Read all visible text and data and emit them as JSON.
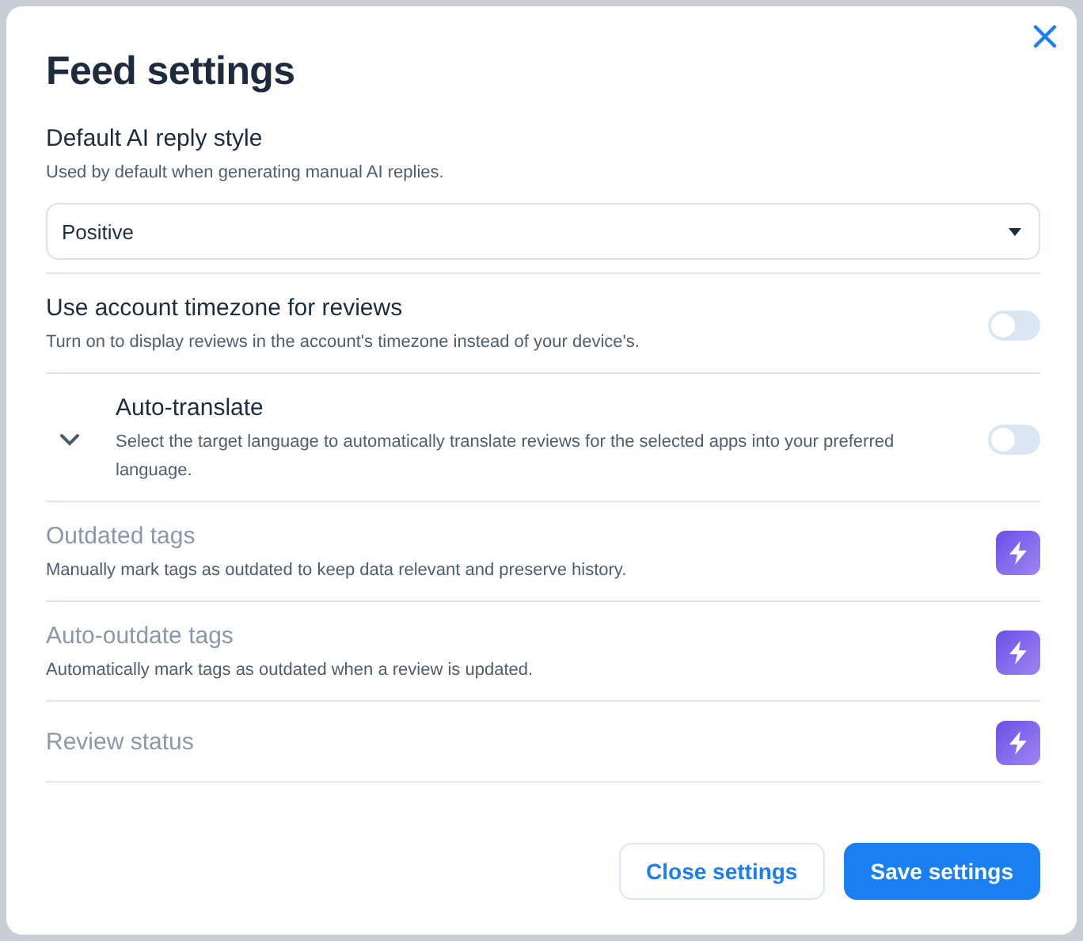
{
  "dialog": {
    "title": "Feed settings"
  },
  "reply_style": {
    "label": "Default AI reply style",
    "description": "Used by default when generating manual AI replies.",
    "value": "Positive"
  },
  "settings": [
    {
      "kind": "toggle",
      "title": "Use account timezone for reviews",
      "description": "Turn on to display reviews in the account's timezone instead of your device's.",
      "on": false
    },
    {
      "kind": "toggle",
      "title": "Auto-translate",
      "description": "Select the target language to automatically translate reviews for the selected apps into your preferred language.",
      "on": false,
      "expander": {
        "expanded": false
      }
    },
    {
      "kind": "premium",
      "title": "Outdated tags",
      "description": "Manually mark tags as outdated to keep data relevant and preserve history."
    },
    {
      "kind": "premium",
      "title": "Auto-outdate tags",
      "description": "Automatically mark tags as outdated when a review is updated."
    },
    {
      "kind": "premium",
      "title": "Review status"
    }
  ],
  "buttons": [
    {
      "kind": "secondary",
      "label": "Close settings"
    },
    {
      "kind": "primary",
      "label": "Save settings"
    }
  ]
}
